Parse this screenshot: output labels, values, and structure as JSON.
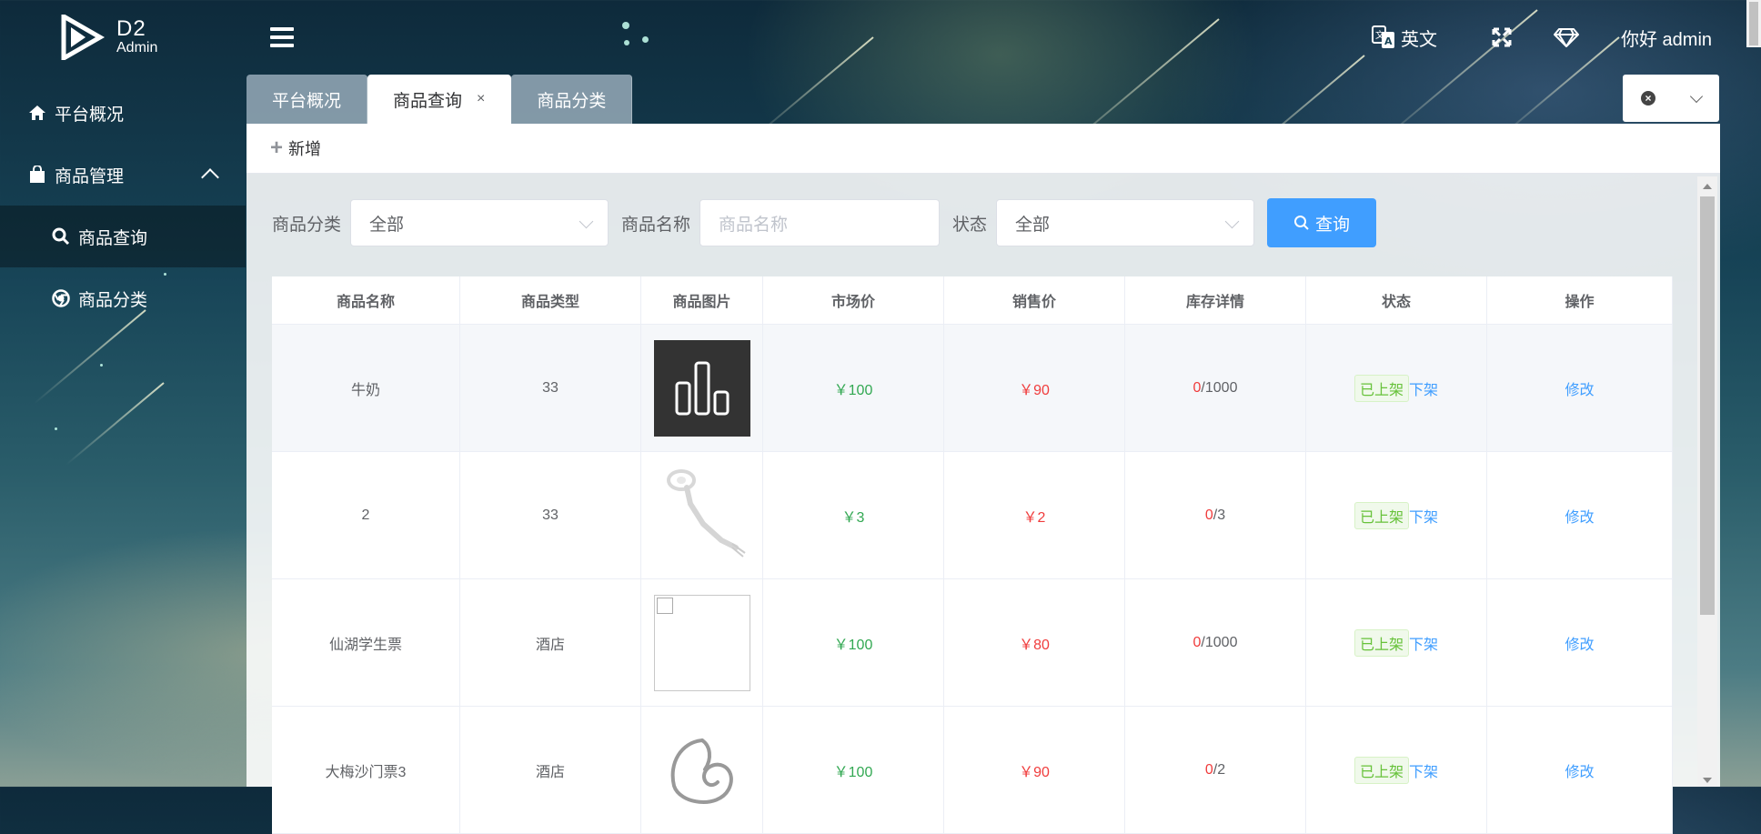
{
  "header": {
    "logo_d2": "D2",
    "logo_admin": "Admin",
    "lang_label": "英文",
    "greeting": "你好 admin"
  },
  "sidebar": {
    "items": [
      {
        "label": "平台概况",
        "icon": "home-icon"
      },
      {
        "label": "商品管理",
        "icon": "shopping-bag-icon"
      },
      {
        "label": "商品查询",
        "icon": "search-icon"
      },
      {
        "label": "商品分类",
        "icon": "chrome-circle-icon"
      }
    ]
  },
  "tabs": [
    {
      "label": "平台概况",
      "active": false
    },
    {
      "label": "商品查询",
      "active": true,
      "close": "×"
    },
    {
      "label": "商品分类",
      "active": false
    }
  ],
  "toolbar": {
    "add_label": "新增"
  },
  "filters": {
    "category_label": "商品分类",
    "category_value": "全部",
    "name_label": "商品名称",
    "name_placeholder": "商品名称",
    "status_label": "状态",
    "status_value": "全部",
    "search_label": "查询"
  },
  "table": {
    "columns": [
      "商品名称",
      "商品类型",
      "商品图片",
      "市场价",
      "销售价",
      "库存详情",
      "状态",
      "操作"
    ],
    "rows": [
      {
        "name": "牛奶",
        "type": "33",
        "image": "bar-chart",
        "market": "￥100",
        "sale": "￥90",
        "stock_sold": "0",
        "stock_total": "/1000",
        "status": "已上架",
        "toggle": "下架",
        "action": "修改"
      },
      {
        "name": "2",
        "type": "33",
        "image": "cable",
        "market": "￥3",
        "sale": "￥2",
        "stock_sold": "0",
        "stock_total": "/3",
        "status": "已上架",
        "toggle": "下架",
        "action": "修改"
      },
      {
        "name": "仙湖学生票",
        "type": "酒店",
        "image": "broken",
        "market": "￥100",
        "sale": "￥80",
        "stock_sold": "0",
        "stock_total": "/1000",
        "status": "已上架",
        "toggle": "下架",
        "action": "修改"
      },
      {
        "name": "大梅沙门票3",
        "type": "酒店",
        "image": "swirl",
        "market": "￥100",
        "sale": "￥90",
        "stock_sold": "0",
        "stock_total": "/2",
        "status": "已上架",
        "toggle": "下架",
        "action": "修改"
      }
    ]
  },
  "colors": {
    "primary": "#409eff",
    "market_price": "#32a852",
    "sale_price": "#f03c3c",
    "tag_green": "#67c23a"
  }
}
